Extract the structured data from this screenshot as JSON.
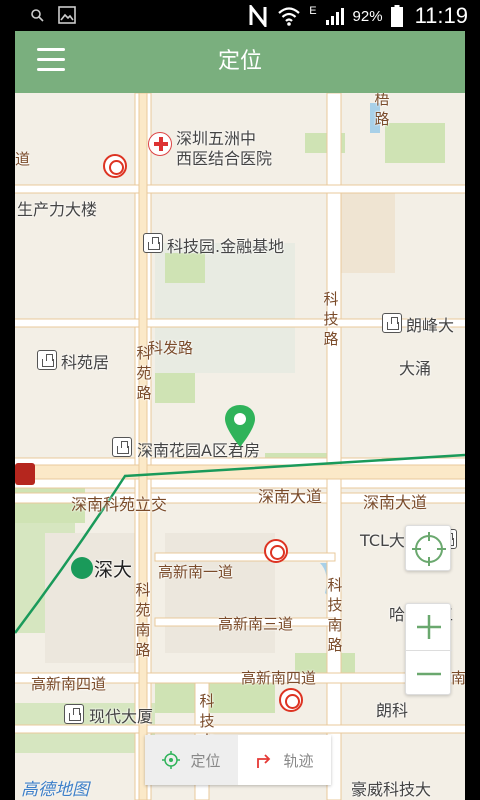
{
  "statusbar": {
    "battery_percent": "92%",
    "time": "11:19",
    "network_type": "E",
    "icons": [
      "search-icon",
      "image-icon",
      "nfc-icon",
      "wifi-icon",
      "signal-icon",
      "battery-icon"
    ]
  },
  "toolbar": {
    "title": "定位",
    "menu_icon": "hamburger-menu-icon"
  },
  "map": {
    "labels": {
      "hospital_line1": "深圳五洲中",
      "hospital_line2": "西医结合医院",
      "shengchanli": "生产力大楼",
      "keji_jinrong": "科技园.金融基地",
      "langfeng": "朗峰大",
      "keyuanju": "科苑居",
      "kefa_road": "科发路",
      "keji_road_top": "科技路",
      "dayong": "大涌",
      "keyuan_road_top": "科苑路",
      "shennan_garden": "深南花园A区君房",
      "shennan_keyuan": "深南科苑立交",
      "shennan_avenue_1": "深南大道",
      "shennan_avenue_2": "深南大道",
      "tcl": "TCL大厦",
      "shenda": "深大",
      "gaoxin_nan1": "高新南一道",
      "gaoxin_nan3": "高新南三道",
      "keji_nan_road": "科技南路",
      "harbin": "哈尔滨工",
      "keyuan_nan_road": "科苑南路",
      "gaoxin_nan4_left": "高新南四道",
      "gaoxin_nan4_right": "高新南四道",
      "xiandai": "现代大厦",
      "keji_nan5": "科技南五",
      "langke": "朗科",
      "haowei": "豪威科技大",
      "nan_edge": "南",
      "wutong_partial": "梧路",
      "amap_logo": "高德地图"
    }
  },
  "controls": {
    "locate_icon": "crosshair-icon",
    "zoom_in_icon": "plus-icon",
    "zoom_out_icon": "minus-icon"
  },
  "bottom_tabs": [
    {
      "label": "定位",
      "icon": "locate-icon",
      "active": true
    },
    {
      "label": "轨迹",
      "icon": "track-arrow-icon",
      "active": false
    }
  ],
  "colors": {
    "toolbar": "#7aaf7e",
    "marker": "#2fb35a",
    "metro": "#dd3322",
    "metro_line": "#1a9a5a"
  }
}
